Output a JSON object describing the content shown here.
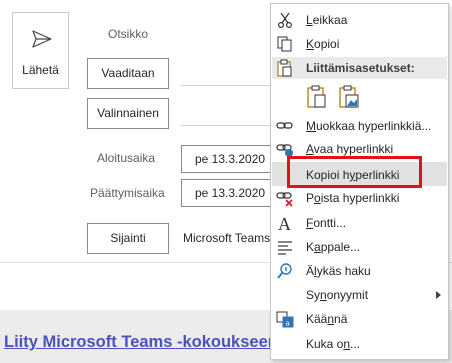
{
  "send": {
    "label": "Lähetä"
  },
  "fields": {
    "title_label": "Otsikko",
    "required_label": "Vaaditaan",
    "optional_label": "Valinnainen",
    "start_label": "Aloitusaika",
    "start_value": "pe 13.3.2020",
    "end_label": "Päättymisaika",
    "end_value": "pe 13.3.2020",
    "location_label": "Sijainti",
    "location_value": "Microsoft Teams"
  },
  "body": {
    "teams_link": "Liity Microsoft Teams -kokoukseen"
  },
  "context_menu": {
    "items": [
      {
        "label": "Leikkaa",
        "icon": "scissors-icon"
      },
      {
        "label": "Kopioi",
        "icon": "copy-icon"
      },
      {
        "label": "Liittämisasetukset:",
        "icon": "clipboard-icon",
        "section": true
      },
      {
        "label": "Muokkaa hyperlinkkiä...",
        "icon": "edit-link-icon"
      },
      {
        "label": "Avaa hyperlinkki",
        "icon": "open-link-icon"
      },
      {
        "label": "Kopioi hyperlinkki",
        "icon": "",
        "hover": true
      },
      {
        "label": "Poista hyperlinkki",
        "icon": "remove-link-icon"
      },
      {
        "label": "Fontti...",
        "icon": "font-icon"
      },
      {
        "label": "Kappale...",
        "icon": "paragraph-icon"
      },
      {
        "label": "Älykäs haku",
        "icon": "smart-lookup-icon"
      },
      {
        "label": "Synonyymit",
        "icon": "",
        "submenu": true
      },
      {
        "label": "Käännä",
        "icon": "translate-icon"
      },
      {
        "label": "Kuka on...",
        "icon": ""
      }
    ],
    "paste_options": [
      "paste-keep-formatting-icon",
      "paste-picture-icon"
    ]
  },
  "colors": {
    "highlight_box": "#e3101e",
    "link": "#4b53bc",
    "hover": "#e1e1e1"
  }
}
